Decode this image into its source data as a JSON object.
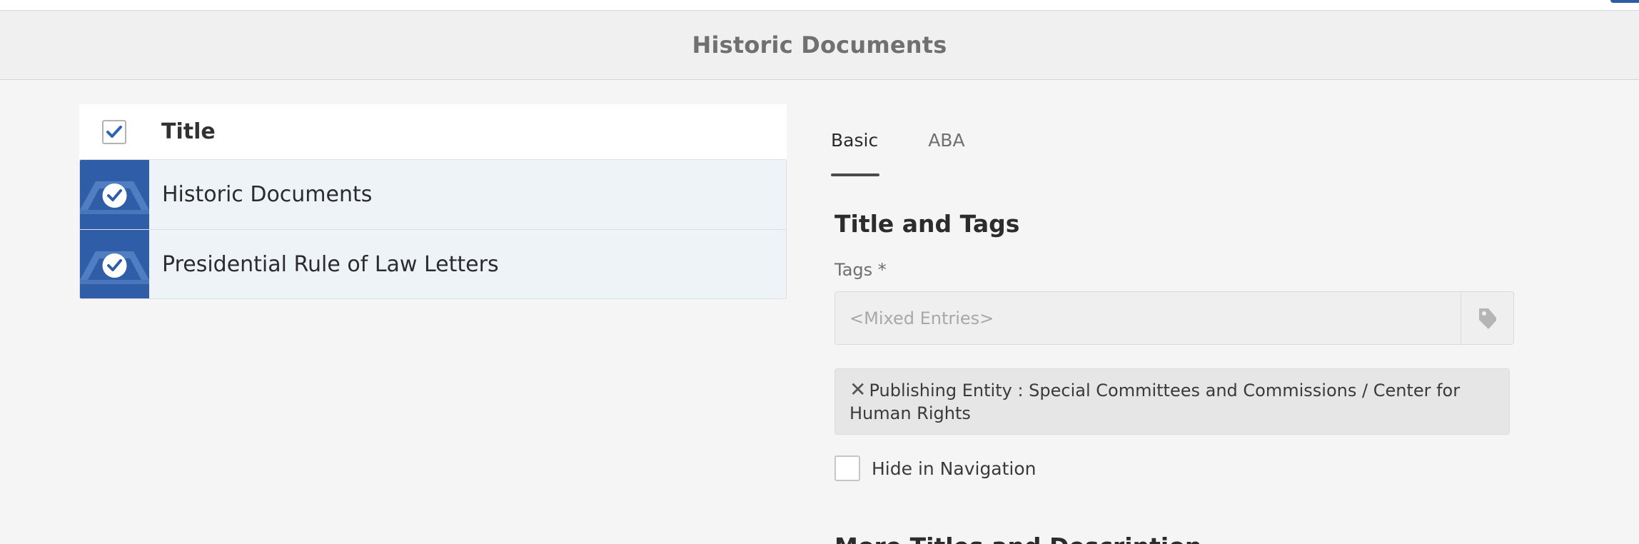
{
  "header": {
    "title": "Historic Documents"
  },
  "list": {
    "column_title": "Title",
    "rows": [
      {
        "label": "Historic Documents"
      },
      {
        "label": "Presidential Rule of Law Letters"
      }
    ]
  },
  "panel": {
    "tabs": [
      {
        "label": "Basic",
        "active": true
      },
      {
        "label": "ABA",
        "active": false
      }
    ],
    "section_title": "Title and Tags",
    "tags_label": "Tags *",
    "tags_placeholder": "<Mixed Entries>",
    "tag_chip": "Publishing Entity : Special Committees and Commissions / Center for Human Rights",
    "hide_nav_label": "Hide in Navigation",
    "more_section_title": "More Titles and Description"
  },
  "icons": {
    "check": "check-icon",
    "tag": "tag-icon",
    "close": "close-icon"
  },
  "colors": {
    "accent": "#2f5da8",
    "row_selected_bg": "#eef3f8"
  }
}
